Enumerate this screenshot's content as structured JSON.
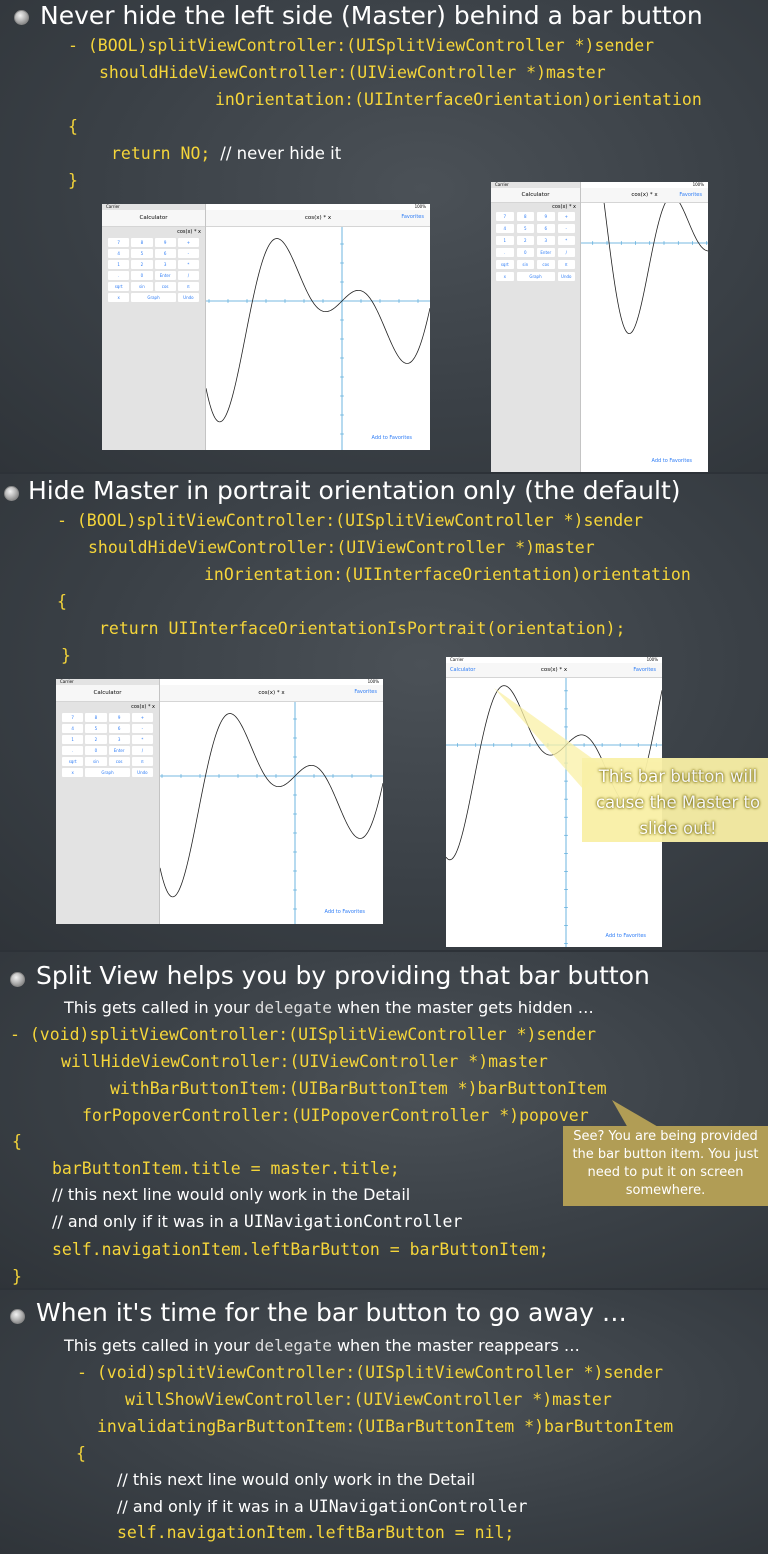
{
  "slide1": {
    "title": "Never hide the left side (Master) behind a bar button",
    "code_lines": [
      "- (BOOL)splitViewController:(UISplitViewController *)sender",
      "shouldHideViewController:(UIViewController *)master",
      "inOrientation:(UIInterfaceOrientation)orientation",
      "{",
      "return NO;",
      "// never hide it",
      "}"
    ]
  },
  "slide2": {
    "title": "Hide Master in portrait orientation only (the default)",
    "code_lines": [
      "- (BOOL)splitViewController:(UISplitViewController *)sender",
      "shouldHideViewController:(UIViewController *)master",
      "inOrientation:(UIInterfaceOrientation)orientation",
      "{",
      "return UIInterfaceOrientationIsPortrait(orientation);",
      "}"
    ],
    "callout": "This bar button will cause the Master to slide out!"
  },
  "slide3": {
    "title": "Split View helps you by providing that bar button",
    "subtitle_pre": "This gets called in your ",
    "subtitle_mono": "delegate",
    "subtitle_post": " when the master gets hidden …",
    "code_lines": [
      "- (void)splitViewController:(UISplitViewController *)sender",
      "willHideViewController:(UIViewController *)master",
      "withBarButtonItem:(UIBarButtonItem *)barButtonItem",
      "forPopoverController:(UIPopoverController *)popover",
      "{",
      "barButtonItem.title = master.title;",
      "// this next line would only work in the Detail",
      "// and only if it was in a ",
      "UINavigationController",
      "self.navigationItem.leftBarButton = barButtonItem;",
      "}"
    ],
    "callout": "See? You are being provided the bar button item. You just need to put it on screen somewhere."
  },
  "slide4": {
    "title": "When it's time for the bar button to go away …",
    "subtitle_pre": "This gets called in your ",
    "subtitle_mono": "delegate",
    "subtitle_post": " when the master reappears …",
    "code_lines": [
      "- (void)splitViewController:(UISplitViewController *)sender",
      "willShowViewController:(UIViewController *)master",
      "invalidatingBarButtonItem:(UIBarButtonItem *)barButtonItem",
      "{",
      "// this next line would only work in the Detail",
      "// and only if it was in a ",
      "UINavigationController",
      "self.navigationItem.leftBarButton = nil;"
    ]
  },
  "app": {
    "carrier": "Carrier",
    "battery": "100%",
    "master_title": "Calculator",
    "detail_title": "cos(x) * x",
    "favorites": "Favorites",
    "add_to_favorites": "Add to Favorites",
    "display": "cos(x) * x",
    "back_button": "Calculator",
    "keys": [
      "7",
      "8",
      "9",
      "+",
      "4",
      "5",
      "6",
      "-",
      "1",
      "2",
      "3",
      "*",
      ".",
      "0",
      "Enter",
      "/",
      "sqrt",
      "sin",
      "cos",
      "π",
      "x",
      "Graph",
      "Undo"
    ]
  }
}
